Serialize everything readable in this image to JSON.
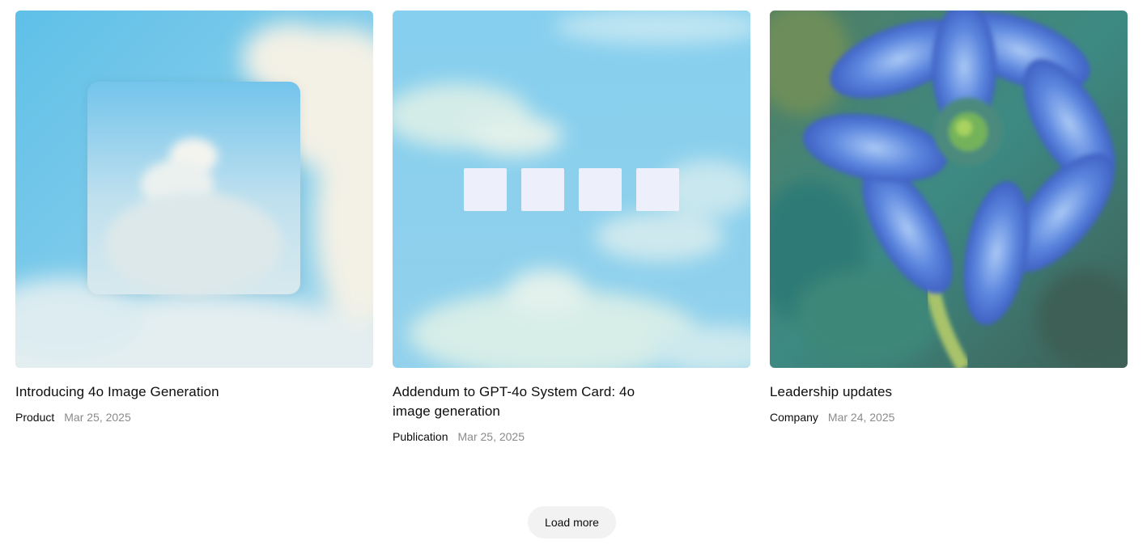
{
  "cards": [
    {
      "title": "Introducing 4o Image Generation",
      "category": "Product",
      "date": "Mar 25, 2025",
      "image": "sky-cloud-square-painting"
    },
    {
      "title": "Addendum to GPT-4o System Card: 4o image generation",
      "category": "Publication",
      "date": "Mar 25, 2025",
      "image": "sky-four-squares-painting"
    },
    {
      "title": "Leadership updates",
      "category": "Company",
      "date": "Mar 24, 2025",
      "image": "blue-flower-painting"
    }
  ],
  "load_more_label": "Load more"
}
